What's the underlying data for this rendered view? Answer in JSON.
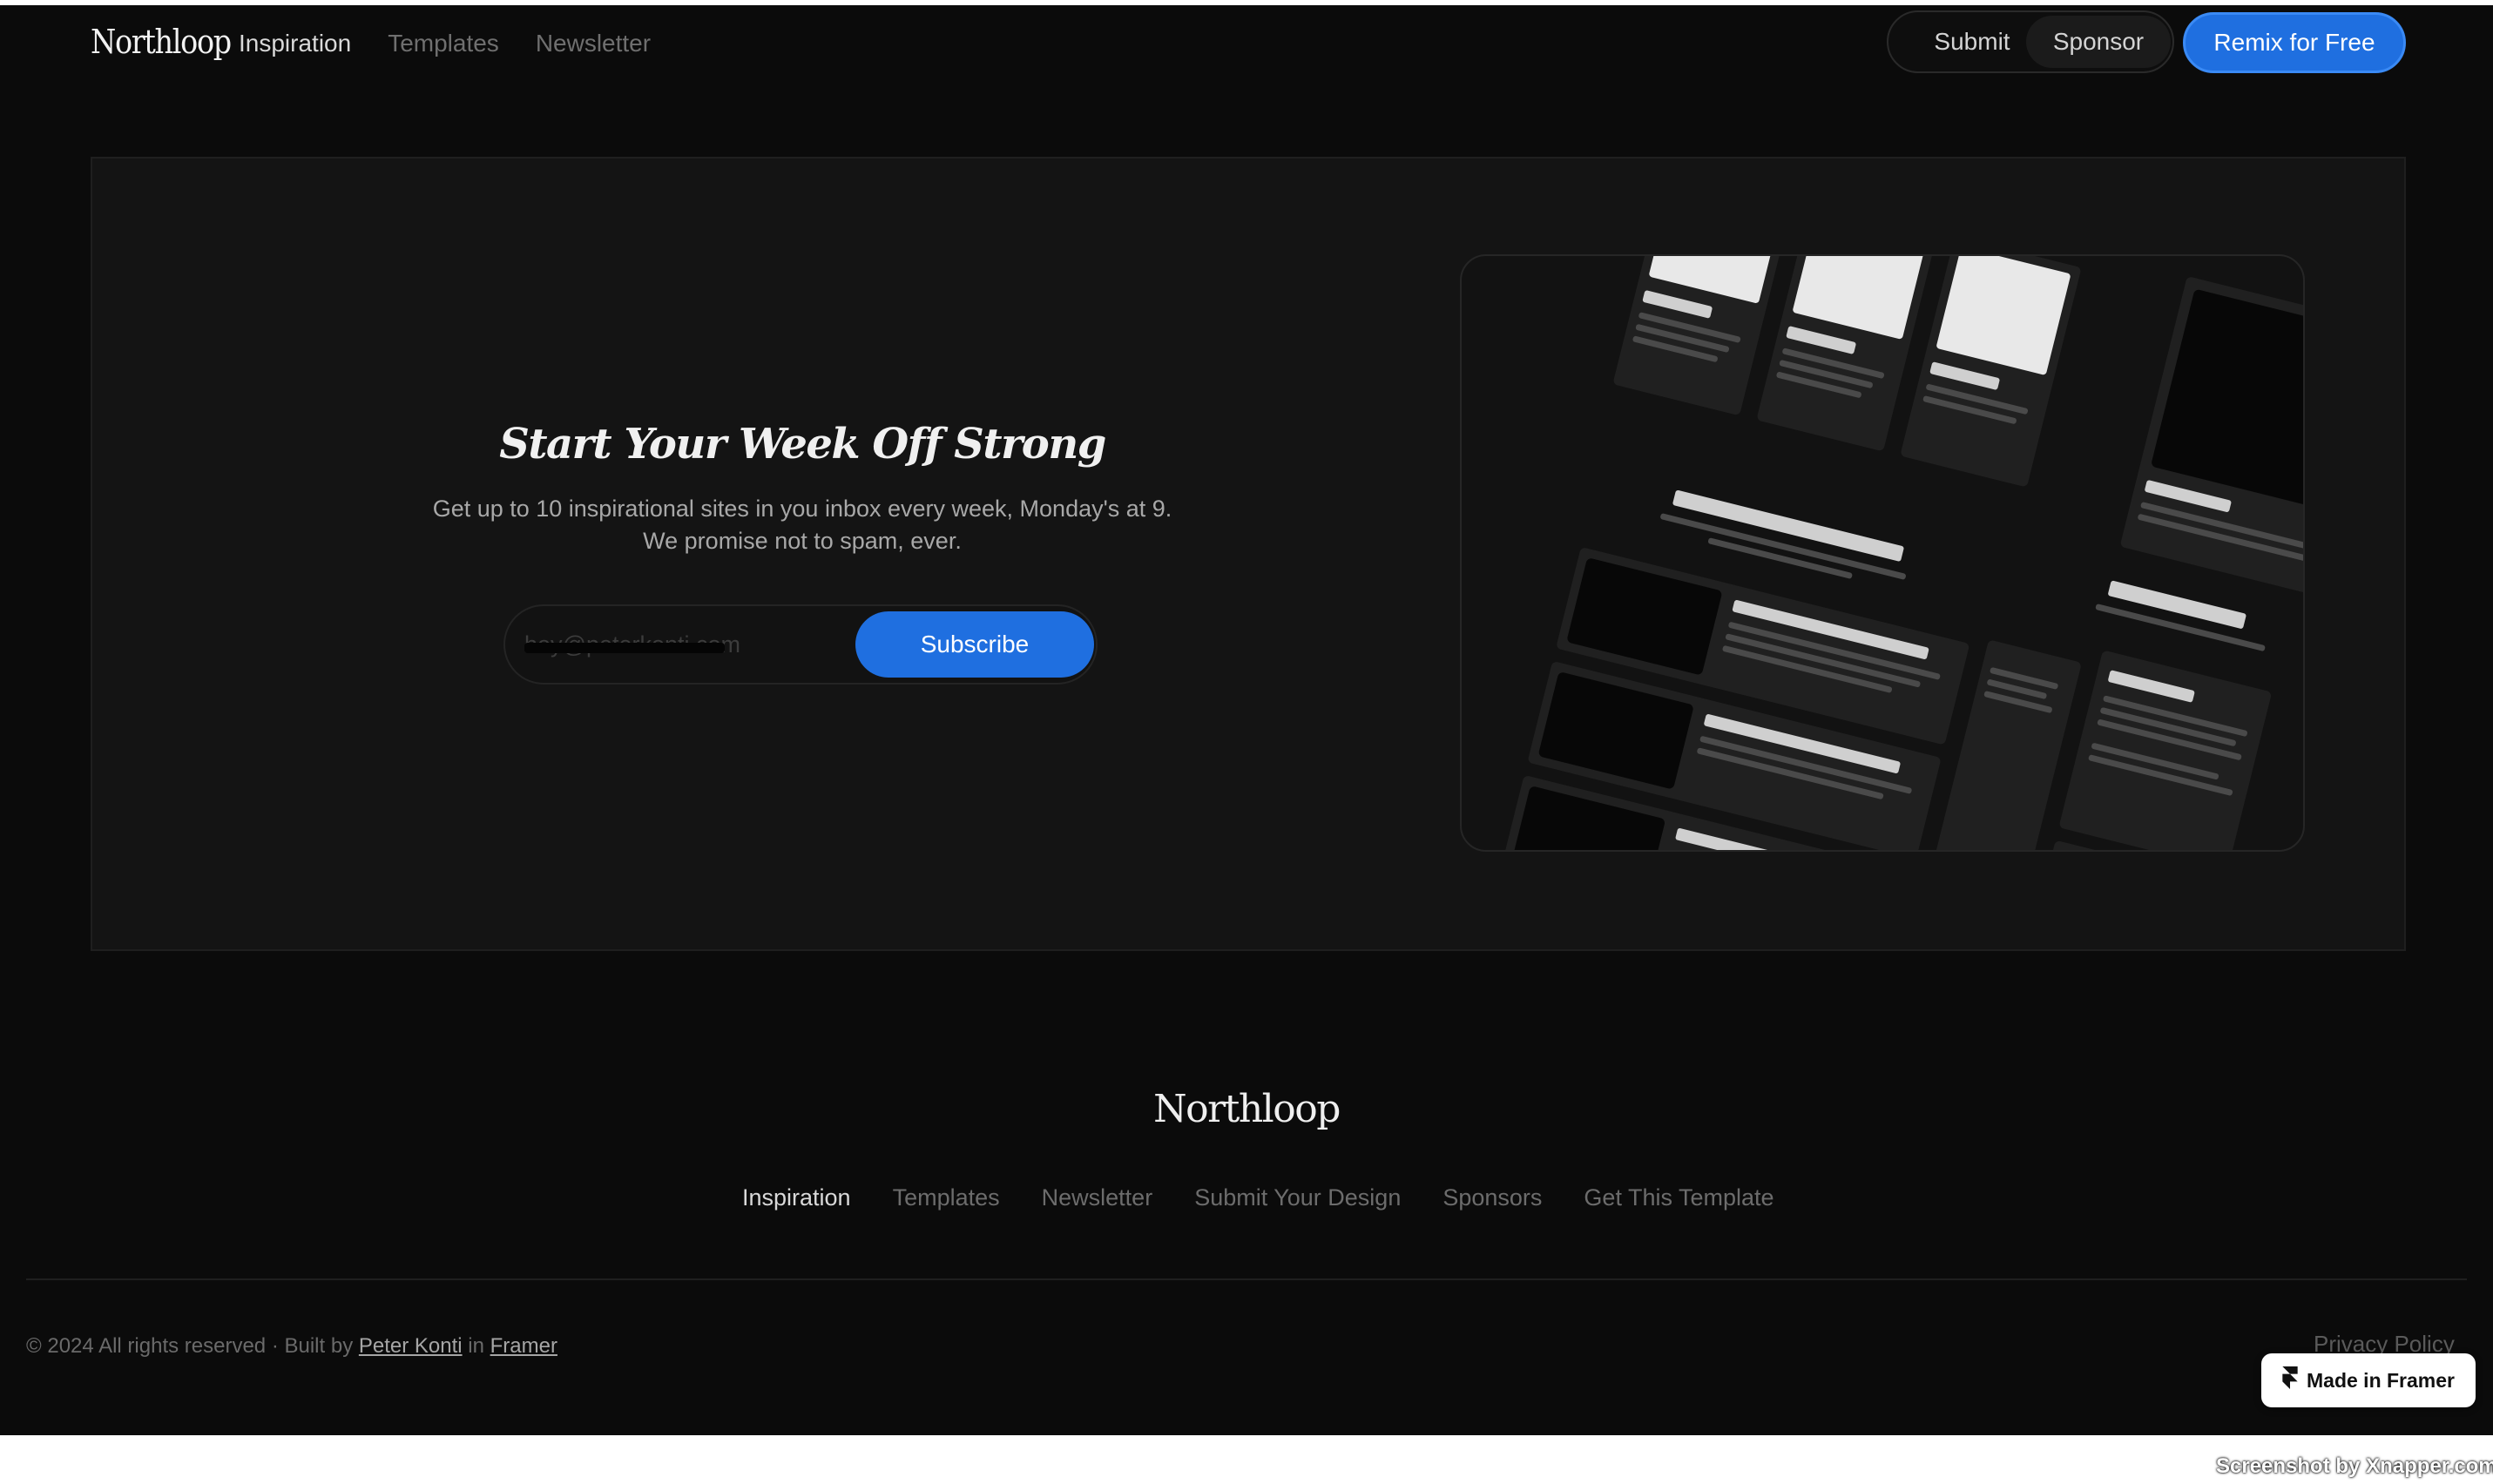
{
  "header": {
    "logo": "Northloop",
    "nav": [
      "Inspiration",
      "Templates",
      "Newsletter"
    ],
    "submit_label": "Submit",
    "sponsor_label": "Sponsor",
    "remix_label": "Remix for Free"
  },
  "newsletter": {
    "title": "Start Your Week Off Strong",
    "line1": "Get up to 10 inspirational sites in you inbox every week, Monday's at 9.",
    "line2": "We promise not to spam, ever.",
    "email_value": "hey@peterkonti.com",
    "subscribe_label": "Subscribe"
  },
  "footer": {
    "logo": "Northloop",
    "nav": [
      "Inspiration",
      "Templates",
      "Newsletter",
      "Submit Your Design",
      "Sponsors",
      "Get This Template"
    ],
    "copyright_prefix": "© 2024 All rights reserved · Built by",
    "author_link": "Peter Konti",
    "in_word": "in",
    "framer_link": "Framer",
    "privacy": "Privacy Policy"
  },
  "badge": {
    "label": "Made in Framer",
    "icon": "framer-icon"
  },
  "watermark": "Screenshot by Xnapper.com",
  "colors": {
    "background": "#0b0b0b",
    "panel": "#141414",
    "accent": "#1f6fe0"
  }
}
